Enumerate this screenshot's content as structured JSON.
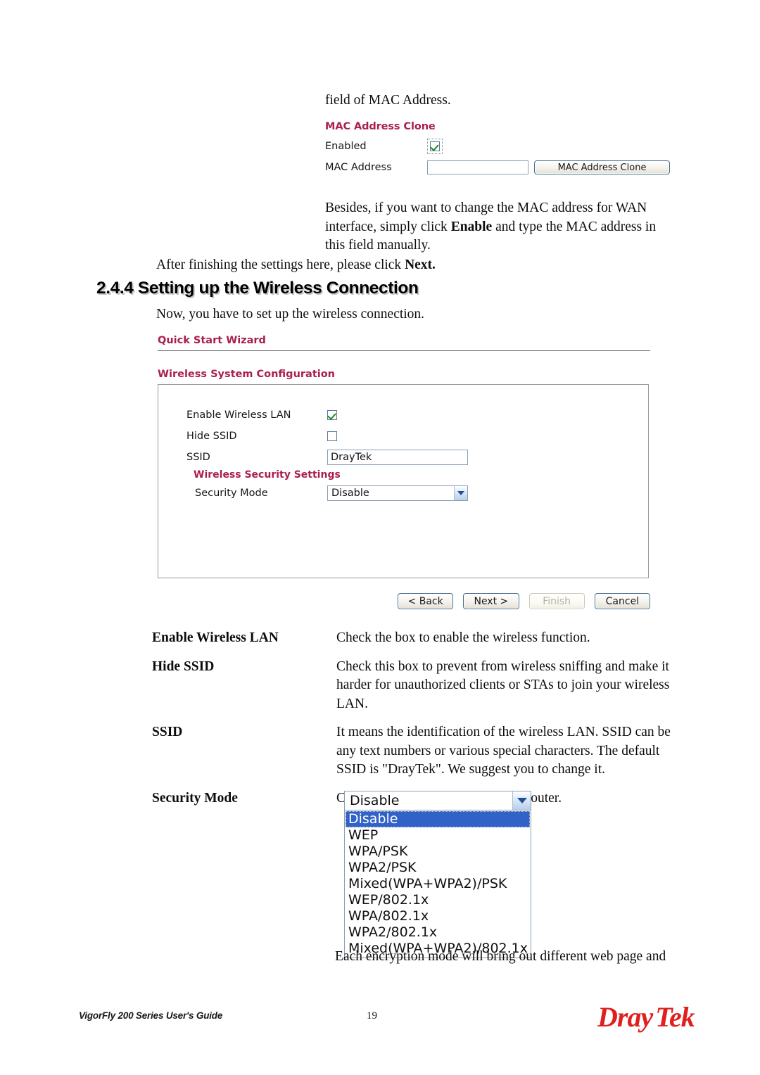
{
  "intro": {
    "line": "field of MAC Address."
  },
  "mac_clone": {
    "title": "MAC Address Clone",
    "enabled_label": "Enabled",
    "enabled_checked": true,
    "mac_address_label": "MAC Address",
    "mac_address_value": "",
    "clone_button_label": "MAC Address Clone"
  },
  "paragraphs": {
    "besides_1": "Besides, if you want to change the MAC address for WAN interface, simply click ",
    "besides_bold": "Enable",
    "besides_2": " and type the MAC address in this field manually.",
    "after_finishing_1": "After finishing the settings here, please click ",
    "after_finishing_bold": "Next.",
    "now_you_have": "Now, you have to set up the wireless connection.",
    "closing": "Each encryption mode will bring out different web page and"
  },
  "section": {
    "heading": "2.4.4 Setting up the Wireless Connection"
  },
  "wizard": {
    "title": "Quick Start Wizard",
    "config_title": "Wireless System Configuration",
    "enable_wireless_lan_label": "Enable Wireless LAN",
    "enable_wireless_lan_checked": true,
    "hide_ssid_label": "Hide SSID",
    "hide_ssid_checked": false,
    "ssid_label": "SSID",
    "ssid_value": "DrayTek",
    "security_settings_title": "Wireless Security Settings",
    "security_mode_label": "Security Mode",
    "security_mode_value": "Disable",
    "buttons": {
      "back": "< Back",
      "next": "Next >",
      "finish": "Finish",
      "cancel": "Cancel"
    }
  },
  "definitions": [
    {
      "term": "Enable Wireless LAN",
      "desc": "Check the box to enable the wireless function."
    },
    {
      "term": "Hide SSID",
      "desc": "Check this box to prevent from wireless sniffing and make it harder for unauthorized clients or STAs to join your wireless LAN."
    },
    {
      "term": "SSID",
      "desc": "It means the identification of the wireless LAN. SSID can be any text numbers or various special characters. The default SSID is \"DrayTek\". We suggest you to change it."
    },
    {
      "term": "Security Mode",
      "desc": "Choose the wireless mode for this router."
    }
  ],
  "security_dropdown": {
    "selected": "Disable",
    "options": [
      "Disable",
      "WEP",
      "WPA/PSK",
      "WPA2/PSK",
      "Mixed(WPA+WPA2)/PSK",
      "WEP/802.1x",
      "WPA/802.1x",
      "WPA2/802.1x",
      "Mixed(WPA+WPA2)/802.1x"
    ]
  },
  "footer": {
    "guide": "VigorFly 200 Series User's Guide",
    "page_number": "19",
    "logo_dray": "Dray",
    "logo_tek": "Tek"
  },
  "colors": {
    "heading_accent": "#aa1f4f",
    "logo_red": "#e01f1f",
    "select_highlight": "#3162c8",
    "check_green": "#1a8a1a"
  }
}
